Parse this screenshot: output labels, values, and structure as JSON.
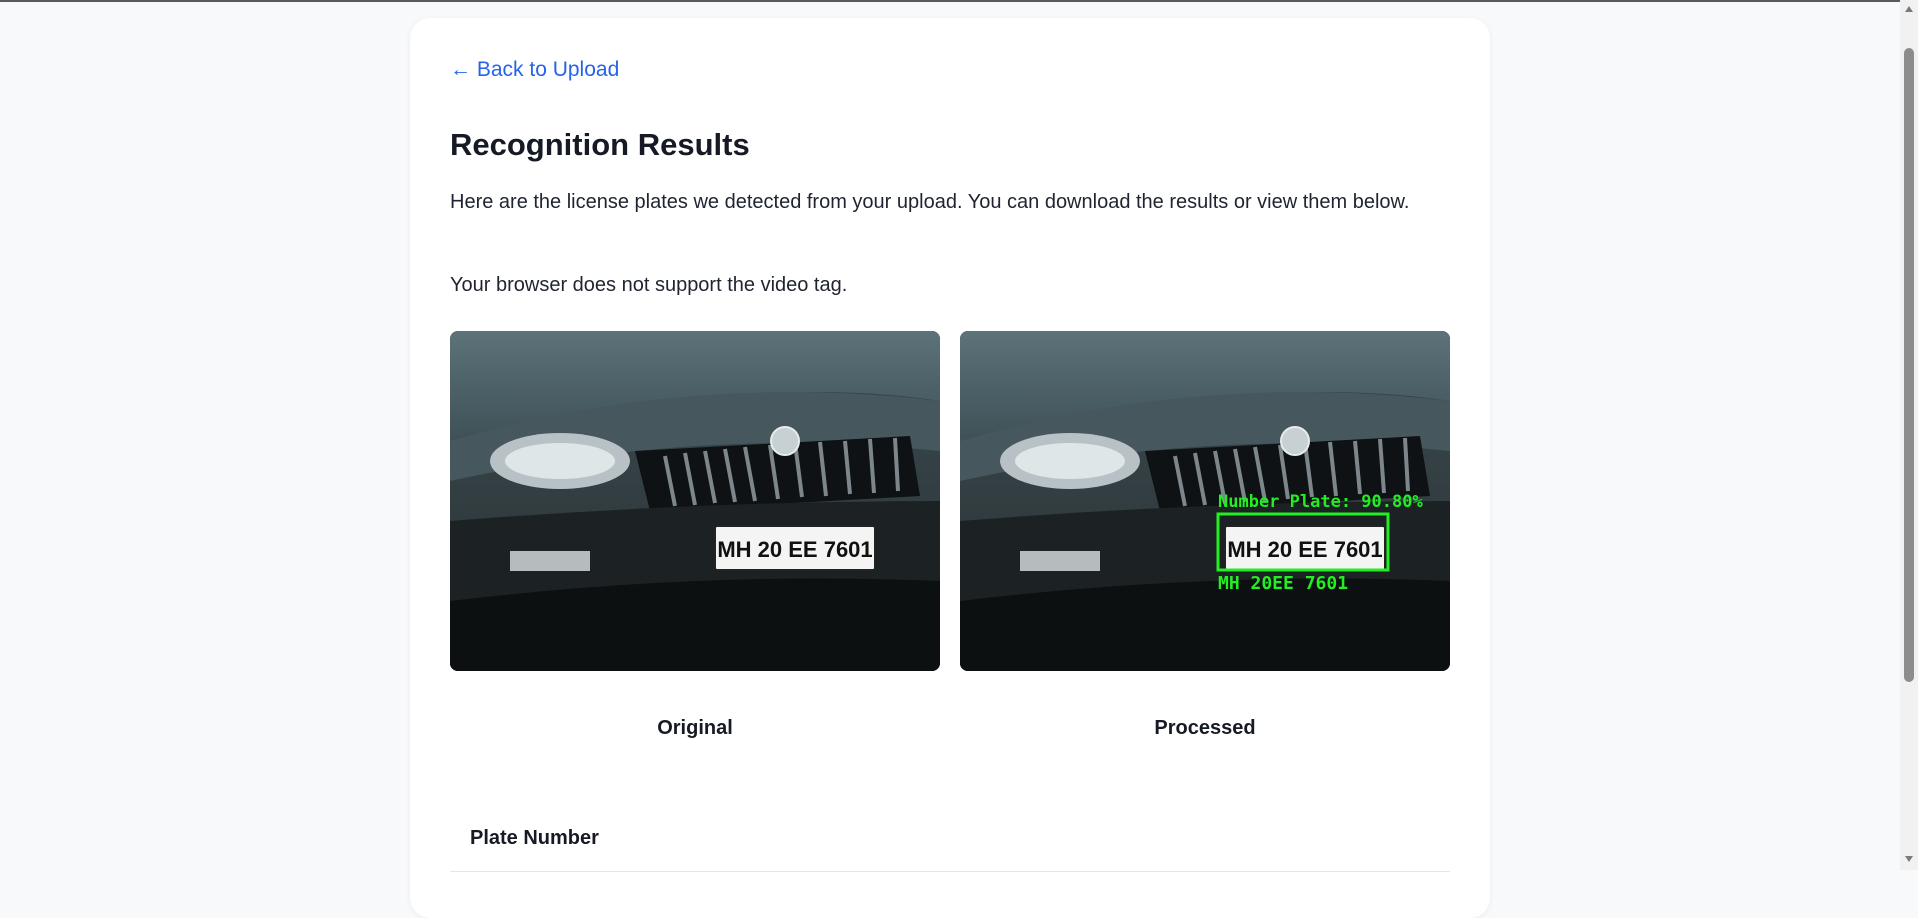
{
  "nav": {
    "back_label": "← Back to Upload"
  },
  "page": {
    "title": "Recognition Results",
    "intro": "Here are the license plates we detected from your upload. You can download the results or view them below.",
    "video_fallback": "Your browser does not support the video tag."
  },
  "images": {
    "original": {
      "caption": "Original",
      "plate_text": "MH 20 EE 7601"
    },
    "processed": {
      "caption": "Processed",
      "plate_text": "MH 20 EE 7601",
      "detection_label": "Number Plate: 90.80%",
      "ocr_label": "MH 20EE 7601",
      "box_color": "#22ee22"
    }
  },
  "table": {
    "headers": [
      "Plate Number"
    ]
  },
  "colors": {
    "link": "#2563eb",
    "background": "#f8f9fb",
    "card": "#ffffff"
  }
}
